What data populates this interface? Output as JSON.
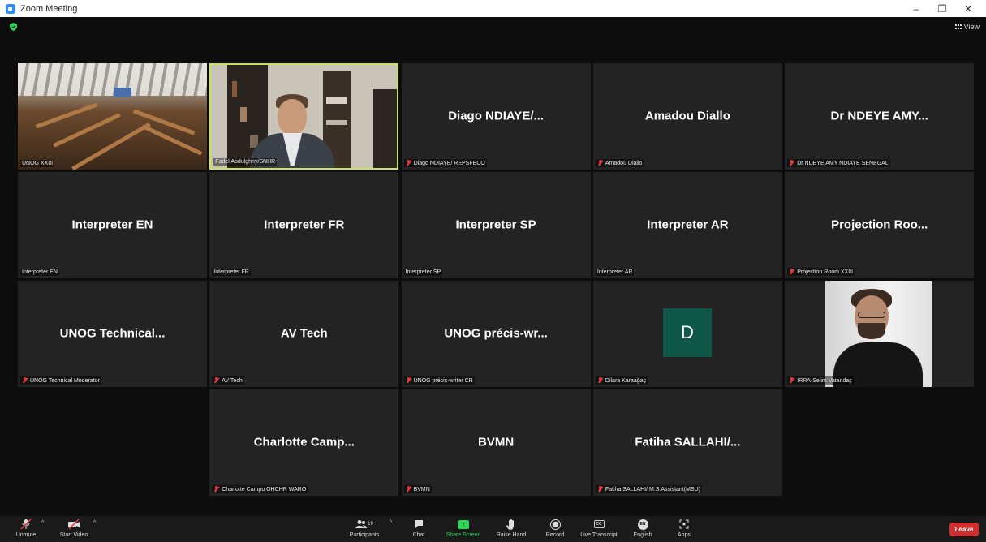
{
  "window": {
    "title": "Zoom Meeting",
    "controls": [
      "–",
      "❐",
      "✕"
    ]
  },
  "meeting": {
    "view_label": "View"
  },
  "tiles": [
    {
      "big": "",
      "label": "UNOG XXIII",
      "muted": false,
      "kind": "room-video"
    },
    {
      "big": "",
      "label": "Fadel Abdulghny/SNHR",
      "muted": false,
      "kind": "speaker-video"
    },
    {
      "big": "Diago  NDIAYE/...",
      "label": "Diago NDIAYE/ REPSFECO",
      "muted": true
    },
    {
      "big": "Amadou Diallo",
      "label": "Amadou Diallo",
      "muted": true
    },
    {
      "big": "Dr NDEYE AMY...",
      "label": "Dr NDEYE AMY NDIAYE SENEGAL",
      "muted": true
    },
    {
      "big": "Interpreter EN",
      "label": "Interpreter EN",
      "muted": false
    },
    {
      "big": "Interpreter FR",
      "label": "Interpreter FR",
      "muted": false
    },
    {
      "big": "Interpreter SP",
      "label": "Interpreter SP",
      "muted": false
    },
    {
      "big": "Interpreter AR",
      "label": "Interpreter AR",
      "muted": false
    },
    {
      "big": "Projection  Roo...",
      "label": "Projection Room XXIII",
      "muted": true
    },
    {
      "big": "UNOG  Technical...",
      "label": "UNOG Technical Moderator",
      "muted": true
    },
    {
      "big": "AV Tech",
      "label": "AV Tech",
      "muted": true
    },
    {
      "big": "UNOG  précis-wr...",
      "label": "UNOG précis-writer CR",
      "muted": true
    },
    {
      "big": "D",
      "label": "Dilara Karaağaç",
      "muted": true,
      "kind": "avatar"
    },
    {
      "big": "",
      "label": "IRRA-Selim Vatandaş",
      "muted": true,
      "kind": "photo"
    },
    {
      "big": "Charlotte  Camp...",
      "label": "Charlotte Campo OHCHR WARO",
      "muted": true
    },
    {
      "big": "BVMN",
      "label": "BVMN",
      "muted": true
    },
    {
      "big": "Fatiha  SALLAHI/...",
      "label": "Fatiha SALLAHI/ M.S.Assistant(MSU)",
      "muted": true
    }
  ],
  "toolbar": {
    "unmute": "Unmute",
    "start_video": "Start Video",
    "participants": "Participants",
    "participants_count": "19",
    "chat": "Chat",
    "share_screen": "Share Screen",
    "raise_hand": "Raise Hand",
    "record": "Record",
    "live_transcript": "Live Transcript",
    "cc_text": "CC",
    "english": "English",
    "en_badge": "EN",
    "apps": "Apps",
    "leave": "Leave"
  },
  "colors": {
    "speaking_border": "#c9e265",
    "muted_icon": "#e0383e",
    "share_green": "#2fd35a",
    "leave_red": "#d02f2f",
    "avatar_bg": "#0f5747"
  }
}
